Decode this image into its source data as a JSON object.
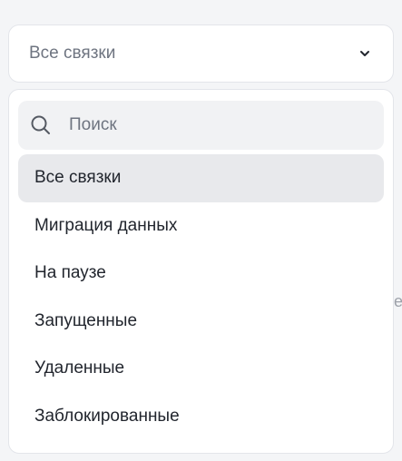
{
  "select": {
    "value": "Все связки"
  },
  "search": {
    "placeholder": "Поиск",
    "value": ""
  },
  "options": [
    {
      "label": "Все связки",
      "selected": true
    },
    {
      "label": "Миграция данных",
      "selected": false
    },
    {
      "label": "На паузе",
      "selected": false
    },
    {
      "label": "Запущенные",
      "selected": false
    },
    {
      "label": "Удаленные",
      "selected": false
    },
    {
      "label": "Заблокированные",
      "selected": false
    }
  ],
  "background_fragment": "е",
  "icons": {
    "trigger": "chevron-down-icon",
    "search": "search-icon"
  },
  "colors": {
    "surface": "#ffffff",
    "page_background": "#f4f5f7",
    "border": "#e3e5ea",
    "search_background": "#f1f2f4",
    "selected_option_background": "#e8e9ec",
    "text_primary": "#22262e",
    "text_muted": "#6e7480"
  }
}
